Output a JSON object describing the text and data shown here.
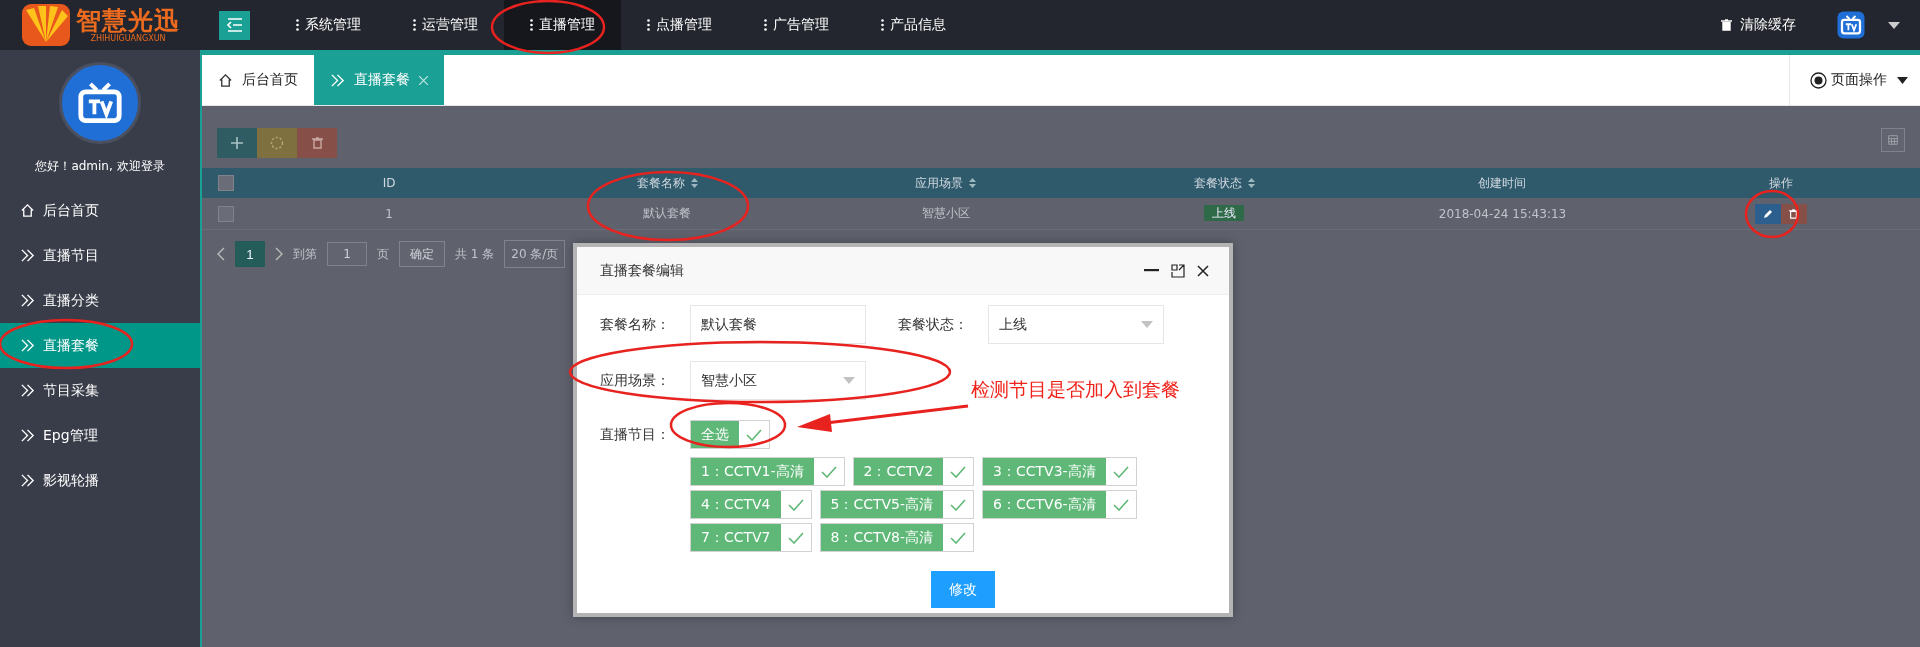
{
  "header": {
    "logo": {
      "name": "智慧光迅",
      "subtitle": "ZHIHUIGUANGXUN"
    },
    "nav": [
      {
        "label": "系统管理",
        "selected": false
      },
      {
        "label": "运营管理",
        "selected": false
      },
      {
        "label": "直播管理",
        "selected": true
      },
      {
        "label": "点播管理",
        "selected": false
      },
      {
        "label": "广告管理",
        "selected": false
      },
      {
        "label": "产品信息",
        "selected": false
      }
    ],
    "clear_cache": "清除缓存"
  },
  "sidebar": {
    "greeting": "您好！admin, 欢迎登录",
    "items": [
      {
        "label": "后台首页",
        "kind": "home",
        "selected": false
      },
      {
        "label": "直播节目",
        "kind": "link",
        "selected": false
      },
      {
        "label": "直播分类",
        "kind": "link",
        "selected": false
      },
      {
        "label": "直播套餐",
        "kind": "link",
        "selected": true
      },
      {
        "label": "节目采集",
        "kind": "link",
        "selected": false
      },
      {
        "label": "Epg管理",
        "kind": "link",
        "selected": false
      },
      {
        "label": "影视轮播",
        "kind": "link",
        "selected": false
      }
    ]
  },
  "tabs": [
    {
      "label": "后台首页",
      "kind": "home",
      "selected": false,
      "closable": false
    },
    {
      "label": "直播套餐",
      "kind": "link",
      "selected": true,
      "closable": true
    }
  ],
  "page_actions": "页面操作",
  "table": {
    "all_checked": false,
    "columns": [
      {
        "label": "ID",
        "sortable": false
      },
      {
        "label": "套餐名称",
        "sortable": true
      },
      {
        "label": "应用场景",
        "sortable": true
      },
      {
        "label": "套餐状态",
        "sortable": true
      },
      {
        "label": "创建时间",
        "sortable": false
      },
      {
        "label": "操作",
        "sortable": false
      }
    ],
    "rows": [
      {
        "checked": false,
        "cells": [
          {
            "kind": "text",
            "text": "1"
          },
          {
            "kind": "text",
            "text": "默认套餐"
          },
          {
            "kind": "text",
            "text": "智慧小区"
          },
          {
            "kind": "badge",
            "text": "上线"
          },
          {
            "kind": "text",
            "text": "2018-04-24 15:43:13"
          },
          {
            "kind": "actions"
          }
        ]
      }
    ]
  },
  "pagination": {
    "current": "1",
    "goto_label": "到第",
    "goto_value": "1",
    "page_unit": "页",
    "confirm": "确定",
    "total": "共 1 条",
    "page_size": "20 条/页"
  },
  "dialog": {
    "title": "直播套餐编辑",
    "fields": [
      {
        "label": "套餐名称：",
        "kind": "text",
        "value": "默认套餐"
      },
      {
        "label": "套餐状态：",
        "kind": "select",
        "value": "上线"
      },
      {
        "label": "应用场景：",
        "kind": "select",
        "value": "智慧小区"
      }
    ],
    "channels_label": "直播节目：",
    "select_all": {
      "label": "全选",
      "checked": true
    },
    "channels": [
      {
        "label": "1：CCTV1-高清",
        "checked": true
      },
      {
        "label": "2：CCTV2",
        "checked": true
      },
      {
        "label": "3：CCTV3-高清",
        "checked": true
      },
      {
        "label": "4：CCTV4",
        "checked": true
      },
      {
        "label": "5：CCTV5-高清",
        "checked": true
      },
      {
        "label": "6：CCTV6-高清",
        "checked": true
      },
      {
        "label": "7：CCTV7",
        "checked": true
      },
      {
        "label": "8：CCTV8-高清",
        "checked": true
      }
    ],
    "submit": "修改"
  },
  "annotation": {
    "note": "检测节目是否加入到套餐"
  }
}
